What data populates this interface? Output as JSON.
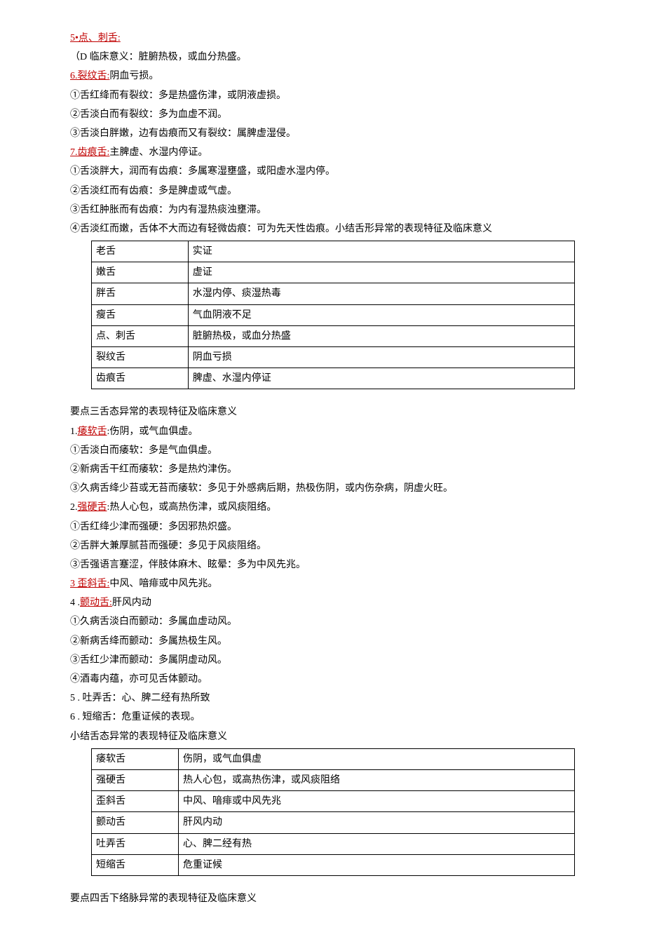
{
  "section5": {
    "title": "5•点、刺舌:",
    "line1": "（D 临床意义：脏腑热极，或血分热盛。"
  },
  "section6": {
    "title": "6.裂纹舌:",
    "suffix": "阴血亏损。",
    "line1": "①舌红绛而有裂纹：多是热盛伤津，或阴液虚损。",
    "line2": "②舌淡白而有裂纹：多为血虚不润。",
    "line3": "③舌淡白胖嫩，边有齿痕而又有裂纹：属脾虚湿侵。"
  },
  "section7": {
    "title": "7.齿痕舌:",
    "suffix": "主脾虚、水湿内停证。",
    "line1": "①舌淡胖大，润而有齿痕：多属寒湿壅盛，或阳虚水湿内停。",
    "line2": "②舌淡红而有齿痕：多是脾虚或气虚。",
    "line3": "③舌红肿胀而有齿痕：为内有湿热痰浊壅滞。",
    "line4": "④舌淡红而嫩，舌体不大而边有轻微齿痕：可为先天性齿痕。小结舌形异常的表现特征及临床意义"
  },
  "table1": {
    "rows": [
      {
        "c1": "老舌",
        "c2": "实证"
      },
      {
        "c1": "嫩舌",
        "c2": "虚证"
      },
      {
        "c1": "胖舌",
        "c2": "水湿内停、痰湿热毒"
      },
      {
        "c1": "瘦舌",
        "c2": "气血阴液不足"
      },
      {
        "c1": "点、刺舌",
        "c2": "脏腑热极，或血分热盛"
      },
      {
        "c1": "裂纹舌",
        "c2": "阴血亏损"
      },
      {
        "c1": "齿痕舌",
        "c2": "脾虚、水湿内停证"
      }
    ]
  },
  "point3": {
    "title": "要点三舌态异常的表现特征及临床意义"
  },
  "p3s1": {
    "prefix": "1.",
    "term": "痿软舌",
    "suffix": ":伤阴，或气血俱虚。",
    "line1": "①舌淡白而痿软：多是气血俱虚。",
    "line2": "②新病舌干红而痿软：多是热灼津伤。",
    "line3": "③久病舌绛少苔或无苔而痿软：多见于外感病后期，热极伤阴，或内伤杂病，阴虚火旺。"
  },
  "p3s2": {
    "prefix": "2.",
    "term": "强硬舌",
    "suffix": ":热人心包，或高热伤津，或风痰阻络。",
    "line1": "①舌红绛少津而强硬：多因邪热炽盛。",
    "line2": "②舌胖大兼厚腻苔而强硬：多见于风痰阻络。",
    "line3": "③舌强语言蹇涩，伴肢体麻木、眩晕：多为中风先兆。"
  },
  "p3s3": {
    "prefixterm": "3 歪斜舌:",
    "suffix": "中风、喑痱或中风先兆。"
  },
  "p3s4": {
    "prefix": "4  .",
    "term": "颤动舌:",
    "suffix": "肝风内动",
    "line1": "①久病舌淡白而颤动：多属血虚动风。",
    "line2": "②新病舌绛而颤动：多属热极生风。",
    "line3": "③舌红少津而颤动：多属阴虚动风。",
    "line4": "④酒毒内蕴，亦可见舌体颤动。"
  },
  "p3s5": "5  . 吐弄舌：心、脾二经有热所致",
  "p3s6": "6  . 短缩舌：危重证候的表现。",
  "summary2": "小结舌态异常的表现特征及临床意义",
  "table2": {
    "rows": [
      {
        "c1": "痿软舌",
        "c2": "伤阴，或气血俱虚"
      },
      {
        "c1": "强硬舌",
        "c2": "热人心包，或高热伤津，或风痰阻络"
      },
      {
        "c1": "歪斜舌",
        "c2": "中风、喑痱或中风先兆"
      },
      {
        "c1": "颤动舌",
        "c2": "肝风内动"
      },
      {
        "c1": "吐弄舌",
        "c2": "心、脾二经有热"
      },
      {
        "c1": "短缩舌",
        "c2": "危重证候"
      }
    ]
  },
  "point4": "要点四舌下络脉异常的表现特征及临床意义"
}
